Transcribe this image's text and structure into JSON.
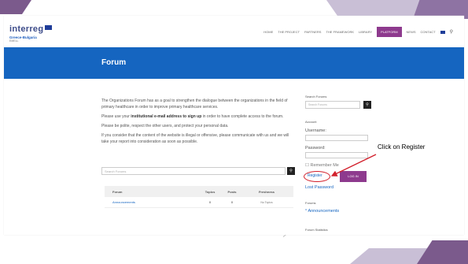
{
  "header": {
    "logo_word": "interreg",
    "logo_sub": "Greece-Bulgaria",
    "logo_fund": "EMELL",
    "nav_items": [
      "HOME",
      "THE PROJECT",
      "PARTNERS",
      "THE FRAMEWORK",
      "LIBRARY",
      "PLATFORM",
      "NEWS",
      "CONTACT"
    ],
    "active_nav": "PLATFORM"
  },
  "banner": {
    "title": "Forum"
  },
  "content": {
    "p1": "The Organizations Forum has as a goal to strengthen the dialogue between the organizations in the field of primary healthcare in order to improve primary healthcare services.",
    "p2_pre": "Please use your ",
    "p2_bold": "institutional e-mail address to sign up",
    "p2_post": " in order to have complete access to the forum.",
    "p3": "Please be polite, respect the other users, and protect your personal data.",
    "p4": "If you consider that the content of the website is illegal or offensive, please communicate with us and we will take your report into consideration as soon as possible.",
    "search_placeholder": "Search Forums"
  },
  "table": {
    "headers": [
      "Forum",
      "Topics",
      "Posts",
      "Freshness"
    ],
    "rows": [
      {
        "forum": "Announcements",
        "topics": "0",
        "posts": "0",
        "freshness": "No Topics"
      }
    ]
  },
  "sidebar": {
    "search_heading": "Search Forums",
    "search_placeholder": "Search Forums",
    "account_heading": "Account",
    "username_label": "Username:",
    "password_label": "Password:",
    "remember_label": "Remember Me",
    "register_label": "Register",
    "login_label": "LOG IN",
    "lost_password": "Lost Password",
    "forums_heading": "Forums",
    "announcements_link": "Announcements",
    "stats_heading": "Forum Statistics"
  },
  "annotation": {
    "callout": "Click on Register",
    "color": "#d21f2b"
  }
}
